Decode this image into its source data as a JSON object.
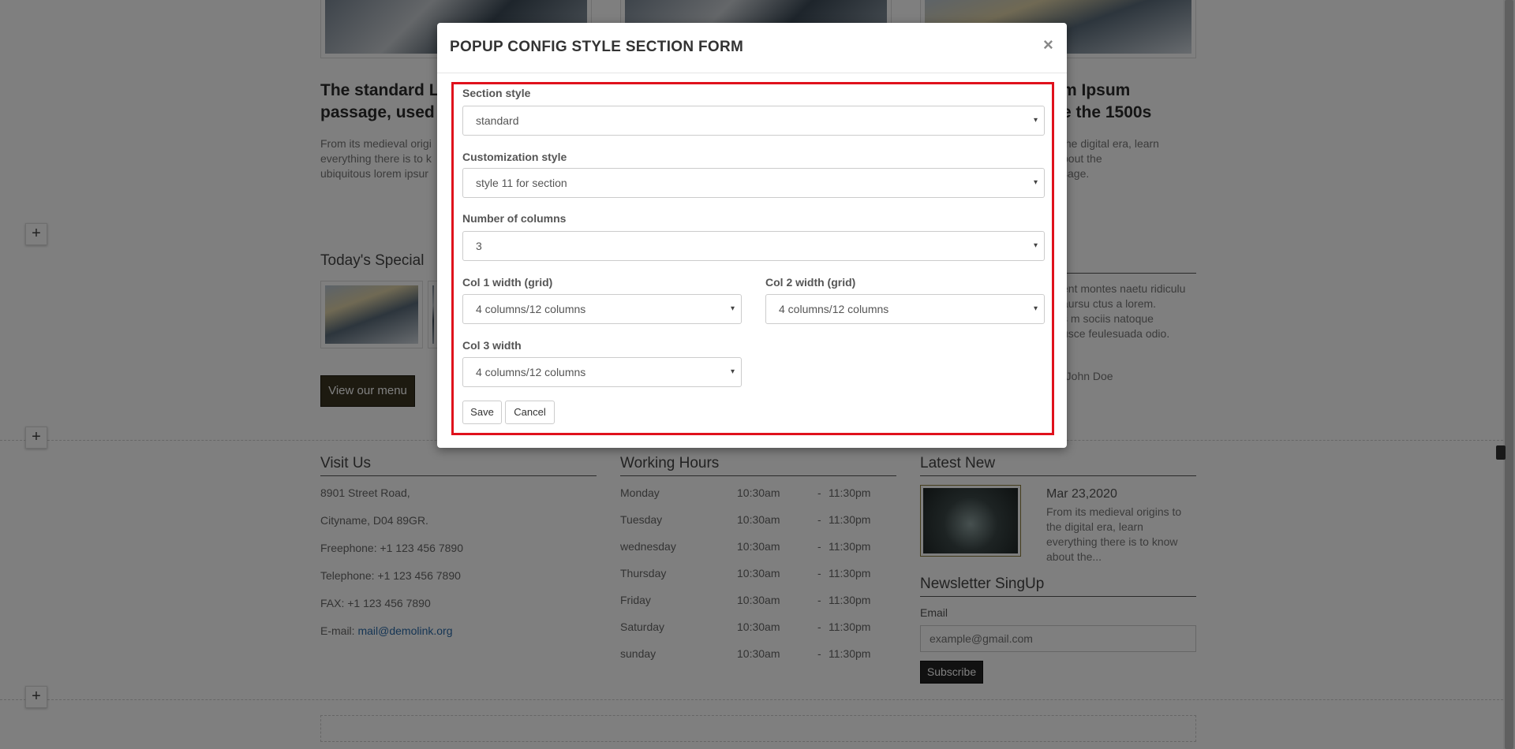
{
  "background": {
    "blog": {
      "left_title": "The standard L\npassage, used s",
      "left_text": "From its medieval origi\neverything there is to k\nubiquitous lorem ipsur",
      "right_title": "m Ipsum\ne the 1500s",
      "right_text": "the digital era, learn\nbout the\nsage."
    },
    "specials": {
      "heading": "Today's Special",
      "menu_button": "View our menu",
      "quote_text": "ent montes naetu ridiculu\naursu ctus a lorem.\ns m sociis natoque\nusce feulesuada odio.",
      "quote_author": "-John Doe"
    },
    "visit": {
      "heading": "Visit Us",
      "lines": [
        "8901 Street Road,",
        "Cityname, D04 89GR.",
        "Freephone: +1 123 456 7890",
        "Telephone: +1 123 456 7890",
        "FAX: +1 123 456 7890"
      ],
      "email_prefix": "E-mail: ",
      "email_link": "mail@demolink.org"
    },
    "hours": {
      "heading": "Working Hours",
      "rows": [
        {
          "day": "Monday",
          "open": "10:30am",
          "sep": "-",
          "close": "11:30pm"
        },
        {
          "day": "Tuesday",
          "open": "10:30am",
          "sep": "-",
          "close": "11:30pm"
        },
        {
          "day": "wednesday",
          "open": "10:30am",
          "sep": "-",
          "close": "11:30pm"
        },
        {
          "day": "Thursday",
          "open": "10:30am",
          "sep": "-",
          "close": "11:30pm"
        },
        {
          "day": "Friday",
          "open": "10:30am",
          "sep": "-",
          "close": "11:30pm"
        },
        {
          "day": "Saturday",
          "open": "10:30am",
          "sep": "-",
          "close": "11:30pm"
        },
        {
          "day": "sunday",
          "open": "10:30am",
          "sep": "-",
          "close": "11:30pm"
        }
      ]
    },
    "latest": {
      "heading": "Latest New",
      "date": "Mar 23,2020",
      "text": "From its medieval origins to\nthe digital era, learn\neverything there is to know\nabout the..."
    },
    "newsletter": {
      "heading": "Newsletter SingUp",
      "email_label": "Email",
      "email_placeholder": "example@gmail.com",
      "subscribe_label": "Subscribe"
    },
    "plus_label": "+"
  },
  "modal": {
    "title": "POPUP CONFIG STYLE SECTION FORM",
    "close_label": "×",
    "fields": {
      "section_style_label": "Section style",
      "section_style_value": "standard",
      "customization_label": "Customization style",
      "customization_value": "style 11 for section",
      "columns_label": "Number of columns",
      "columns_value": "3",
      "col1_label": "Col 1 width (grid)",
      "col1_value": "4 columns/12 columns",
      "col2_label": "Col 2 width (grid)",
      "col2_value": "4 columns/12 columns",
      "col3_label": "Col 3 width",
      "col3_value": "4 columns/12 columns"
    },
    "caret": "▾",
    "save_label": "Save",
    "cancel_label": "Cancel"
  }
}
